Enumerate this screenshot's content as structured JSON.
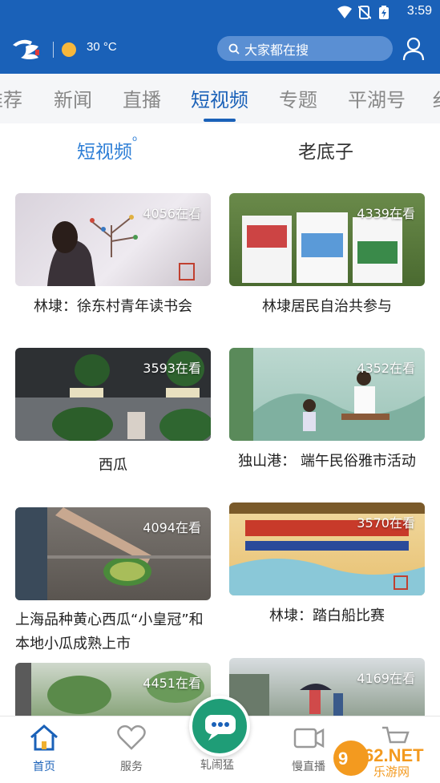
{
  "status_bar": {
    "time": "3:59"
  },
  "header": {
    "temperature": "30 °C",
    "search_placeholder": "大家都在搜"
  },
  "tabs": [
    {
      "label": "推荐"
    },
    {
      "label": "新闻"
    },
    {
      "label": "直播"
    },
    {
      "label": "短视频"
    },
    {
      "label": "专题"
    },
    {
      "label": "平湖号"
    }
  ],
  "subtabs": [
    {
      "label": "短视频"
    },
    {
      "label": "老底子"
    }
  ],
  "videos": [
    {
      "views": "4056在看",
      "title": "林埭：徐东村青年读书会"
    },
    {
      "views": "4339在看",
      "title": "林埭居民自治共参与"
    },
    {
      "views": "3593在看",
      "title": "西瓜"
    },
    {
      "views": "4352在看",
      "title": "独山港： 端午民俗雅市活动"
    },
    {
      "views": "4094在看",
      "title": "上海品种黄心西瓜“小皇冠”和本地小瓜成熟上市"
    },
    {
      "views": "3570在看",
      "title": "林埭：踏白船比赛"
    },
    {
      "views": "4451在看",
      "title": ""
    },
    {
      "views": "4169在看",
      "title": ""
    }
  ],
  "bottom_nav": [
    {
      "label": "首页"
    },
    {
      "label": "服务"
    },
    {
      "label": "轧闹猛"
    },
    {
      "label": "慢直播"
    },
    {
      "label": ""
    }
  ],
  "watermark": {
    "text": "962.NET",
    "subtext": "乐游网"
  },
  "colors": {
    "brand": "#1a61b8",
    "accent": "#2f7fd6",
    "fab": "#1f9d77"
  }
}
